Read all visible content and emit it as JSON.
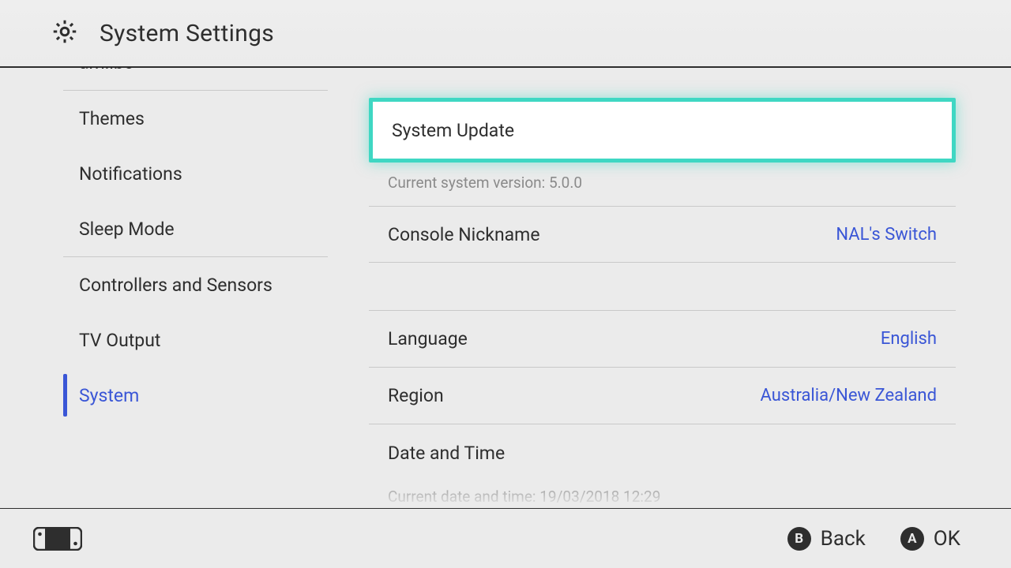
{
  "header": {
    "title": "System Settings"
  },
  "sidebar": {
    "items": [
      {
        "id": "amiibo",
        "label": "amiibo"
      },
      {
        "id": "themes",
        "label": "Themes"
      },
      {
        "id": "notif",
        "label": "Notifications"
      },
      {
        "id": "sleep",
        "label": "Sleep Mode"
      },
      {
        "id": "controllers",
        "label": "Controllers and Sensors"
      },
      {
        "id": "tv",
        "label": "TV Output"
      },
      {
        "id": "system",
        "label": "System",
        "active": true
      }
    ]
  },
  "content": {
    "system_update": {
      "label": "System Update",
      "sub": "Current system version: 5.0.0"
    },
    "nickname": {
      "label": "Console Nickname",
      "value": "NAL's Switch"
    },
    "language": {
      "label": "Language",
      "value": "English"
    },
    "region": {
      "label": "Region",
      "value": "Australia/New Zealand"
    },
    "datetime": {
      "label": "Date and Time",
      "sub": "Current date and time: 19/03/2018 12:29"
    }
  },
  "footer": {
    "back": {
      "glyph": "B",
      "label": "Back"
    },
    "ok": {
      "glyph": "A",
      "label": "OK"
    }
  }
}
